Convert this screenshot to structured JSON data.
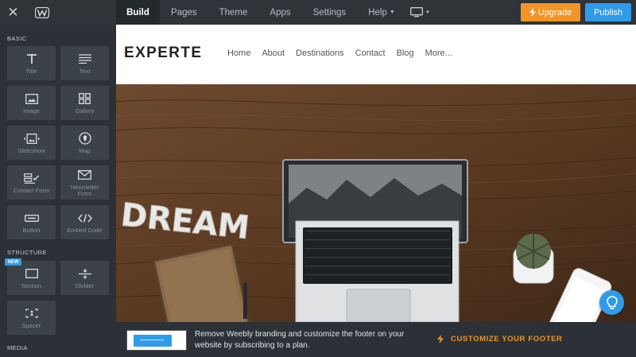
{
  "topbar": {
    "tabs": [
      {
        "label": "Build",
        "active": true
      },
      {
        "label": "Pages"
      },
      {
        "label": "Theme"
      },
      {
        "label": "Apps"
      },
      {
        "label": "Settings"
      },
      {
        "label": "Help"
      }
    ],
    "upgrade_label": "Upgrade",
    "publish_label": "Publish",
    "icons": {
      "close": "close-icon",
      "logo": "weebly-logo",
      "device": "desktop-icon"
    }
  },
  "sidebar": {
    "basic_label": "BASIC",
    "structure_label": "STRUCTURE",
    "media_label": "MEDIA",
    "new_badge": "NEW",
    "basic_items": [
      {
        "label": "Title",
        "icon": "title-icon"
      },
      {
        "label": "Text",
        "icon": "text-icon"
      },
      {
        "label": "Image",
        "icon": "image-icon"
      },
      {
        "label": "Gallery",
        "icon": "gallery-icon"
      },
      {
        "label": "Slideshow",
        "icon": "slideshow-icon"
      },
      {
        "label": "Map",
        "icon": "map-pin-icon"
      },
      {
        "label": "Contact Form",
        "icon": "form-icon"
      },
      {
        "label": "Newsletter Form",
        "icon": "envelope-icon"
      },
      {
        "label": "Button",
        "icon": "button-icon"
      },
      {
        "label": "Embed Code",
        "icon": "code-icon"
      }
    ],
    "structure_items": [
      {
        "label": "Section",
        "icon": "section-icon"
      },
      {
        "label": "Divider",
        "icon": "divider-icon"
      },
      {
        "label": "Spacer",
        "icon": "spacer-icon"
      }
    ]
  },
  "site": {
    "brand": "EXPERTE",
    "nav": [
      "Home",
      "About",
      "Destinations",
      "Contact",
      "Blog",
      "More..."
    ],
    "hero_text": "DREAM"
  },
  "footer_notice": {
    "text": "Remove Weebly branding and customize the footer on your website by subscribing to a plan.",
    "cta": "CUSTOMIZE YOUR FOOTER"
  },
  "colors": {
    "accent_orange": "#f29526",
    "accent_blue": "#2f9bea",
    "sidebar_bg": "#2b3137",
    "tile_bg": "#3b4248"
  }
}
